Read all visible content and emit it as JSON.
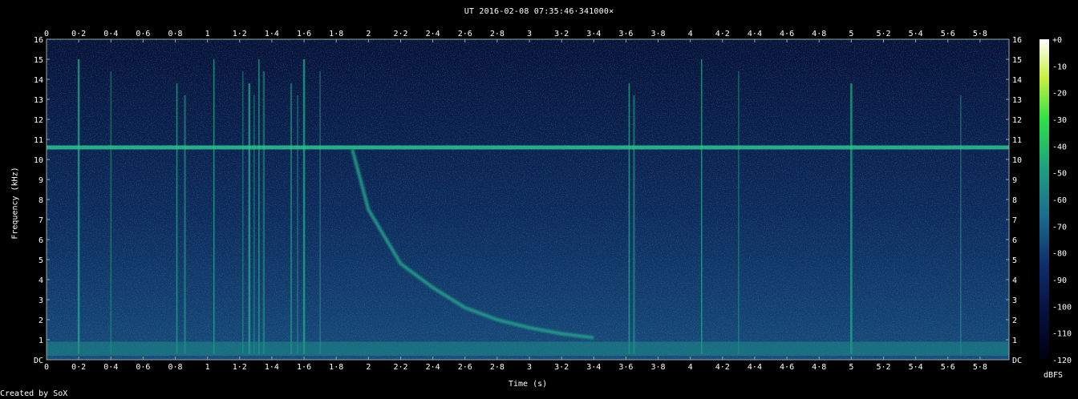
{
  "title": "UT 2016-02-08 07:35:46·341000×",
  "credit": "Created by SoX",
  "chart_data": {
    "type": "heatmap",
    "title": "UT 2016-02-08 07:35:46·341000×",
    "xlabel": "Time (s)",
    "ylabel": "Frequency (kHz)",
    "xlim": [
      0,
      5.98
    ],
    "ylim": [
      0,
      16
    ],
    "x_ticks": [
      "0",
      "0·2",
      "0·4",
      "0·6",
      "0·8",
      "1",
      "1·2",
      "1·4",
      "1·6",
      "1·8",
      "2",
      "2·2",
      "2·4",
      "2·6",
      "2·8",
      "3",
      "3·2",
      "3·4",
      "3·6",
      "3·8",
      "4",
      "4·2",
      "4·4",
      "4·6",
      "4·8",
      "5",
      "5·2",
      "5·4",
      "5·6",
      "5·8"
    ],
    "y_ticks": [
      "DC",
      "1",
      "2",
      "3",
      "4",
      "5",
      "6",
      "7",
      "8",
      "9",
      "10",
      "11",
      "12",
      "13",
      "14",
      "15",
      "16"
    ],
    "colorbar": {
      "label": "dBFS",
      "ticks": [
        "+0",
        "-10",
        "-20",
        "-30",
        "-40",
        "-50",
        "-60",
        "-70",
        "-80",
        "-90",
        "-100",
        "-110",
        "-120"
      ],
      "range": [
        -120,
        0
      ]
    },
    "features": {
      "tone_khz": 10.6,
      "whistler": [
        {
          "t": 1.9,
          "f": 10.5
        },
        {
          "t": 2.0,
          "f": 7.5
        },
        {
          "t": 2.2,
          "f": 4.8
        },
        {
          "t": 2.4,
          "f": 3.6
        },
        {
          "t": 2.6,
          "f": 2.6
        },
        {
          "t": 2.8,
          "f": 2.0
        },
        {
          "t": 3.0,
          "f": 1.6
        },
        {
          "t": 3.2,
          "f": 1.3
        },
        {
          "t": 3.4,
          "f": 1.1
        }
      ],
      "sferics_s": [
        0.2,
        0.4,
        0.81,
        0.86,
        1.04,
        1.22,
        1.26,
        1.29,
        1.32,
        1.35,
        1.52,
        1.56,
        1.6,
        1.7,
        3.62,
        3.65,
        4.07,
        4.3,
        5.0,
        5.68
      ]
    }
  }
}
